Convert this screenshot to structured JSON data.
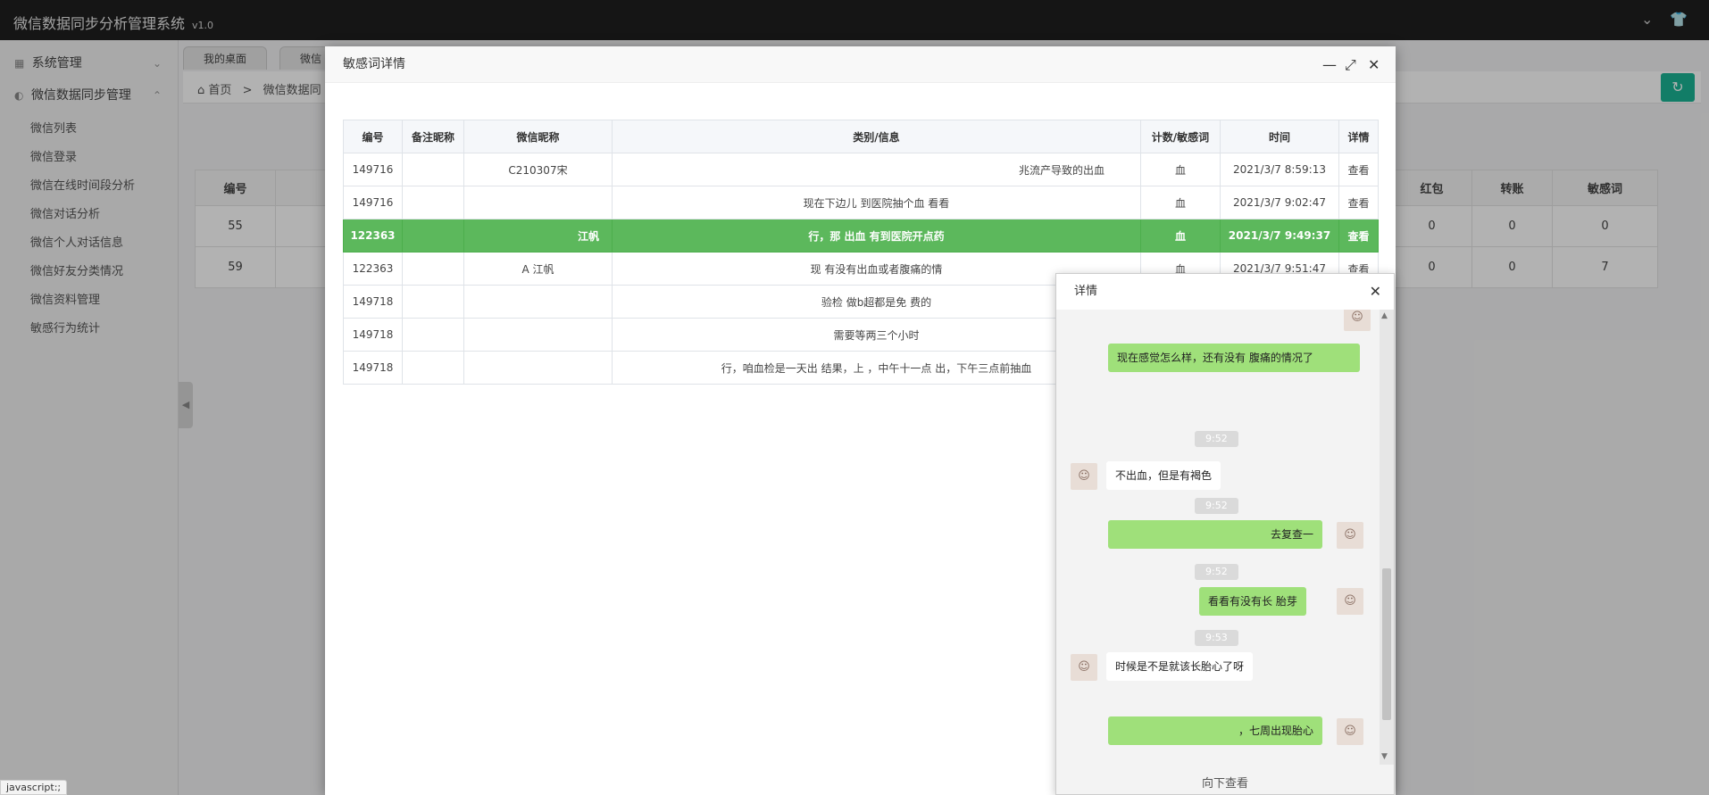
{
  "app": {
    "title": "微信数据同步分析管理系统",
    "version": "v1.0"
  },
  "sidebar": {
    "groups": [
      {
        "label": "系统管理"
      },
      {
        "label": "微信数据同步管理"
      }
    ],
    "items": [
      {
        "label": "微信列表"
      },
      {
        "label": "微信登录"
      },
      {
        "label": "微信在线时间段分析"
      },
      {
        "label": "微信对话分析"
      },
      {
        "label": "微信个人对话信息"
      },
      {
        "label": "微信好友分类情况"
      },
      {
        "label": "微信资料管理"
      },
      {
        "label": "敏感行为统计"
      }
    ]
  },
  "tabs": [
    {
      "label": "我的桌面"
    },
    {
      "label": "微信"
    }
  ],
  "breadcrumb": {
    "home": "首页",
    "separator": ">",
    "current": "微信数据同"
  },
  "background_table": {
    "headers": [
      "编号",
      "",
      "",
      "",
      "",
      "",
      "",
      "",
      "红包",
      "转账",
      "敏感词"
    ],
    "rows": [
      [
        "55",
        "",
        "",
        "",
        "",
        "",
        "",
        "",
        "0",
        "0",
        "0"
      ],
      [
        "59",
        "",
        "",
        "",
        "",
        "",
        "",
        "",
        "0",
        "0",
        "7"
      ]
    ]
  },
  "status_tip": "javascript:;",
  "modal": {
    "title": "敏感词详情",
    "columns": [
      "编号",
      "备注昵称",
      "微信昵称",
      "类别/信息",
      "计数/敏感词",
      "时间",
      "详情"
    ],
    "rows": [
      {
        "id": "149716",
        "remark": "",
        "nickname": "C210307宋",
        "info": "兆流产导致的出血",
        "word": "血",
        "time": "2021/3/7 8:59:13",
        "action": "查看",
        "selected": false
      },
      {
        "id": "149716",
        "remark": "",
        "nickname": "",
        "info": "现在下边儿                          到医院抽个血 看看",
        "word": "血",
        "time": "2021/3/7 9:02:47",
        "action": "查看",
        "selected": false
      },
      {
        "id": "122363",
        "remark": "",
        "nickname": "江帆",
        "info": "行，那         出血     有到医院开点药",
        "word": "血",
        "time": "2021/3/7 9:49:37",
        "action": "查看",
        "selected": true
      },
      {
        "id": "122363",
        "remark": "",
        "nickname": "A              江帆",
        "info": "现       有没有出血或者腹痛的情",
        "word": "血",
        "time": "2021/3/7 9:51:47",
        "action": "查看",
        "selected": false
      },
      {
        "id": "149718",
        "remark": "",
        "nickname": "",
        "info": "验检 做b超都是免 费的",
        "word": "",
        "time": "",
        "action": "",
        "selected": false
      },
      {
        "id": "149718",
        "remark": "",
        "nickname": "",
        "info": "需要等两三个小时",
        "word": "",
        "time": "",
        "action": "",
        "selected": false
      },
      {
        "id": "149718",
        "remark": "",
        "nickname": "",
        "info": "行，咱血检是一天出     结果，上           ，中午十一点     出，下午三点前抽血",
        "word": "",
        "time": "",
        "action": "",
        "selected": false
      }
    ]
  },
  "chat": {
    "title": "详情",
    "messages": [
      {
        "type": "bubble",
        "side": "me",
        "text": "现在感觉怎么样，还有没有     腹痛的情况了"
      },
      {
        "type": "time",
        "text": "9:52"
      },
      {
        "type": "bubble",
        "side": "other",
        "text": "不出血，但是有褐色"
      },
      {
        "type": "time",
        "text": "9:52"
      },
      {
        "type": "bubble",
        "side": "me",
        "text": "去复查一"
      },
      {
        "type": "time",
        "text": "9:52"
      },
      {
        "type": "bubble",
        "side": "me",
        "text": "看看有没有长     胎芽"
      },
      {
        "type": "time",
        "text": "9:53"
      },
      {
        "type": "bubble",
        "side": "other",
        "text": "时候是不是就该长胎心了呀"
      },
      {
        "type": "bubble",
        "side": "me",
        "text": "，七周出现胎心"
      }
    ],
    "footer": "向下查看"
  },
  "colors": {
    "accent": "#5cb85c",
    "topbar": "#1f1f1f",
    "refresh": "#1ab394",
    "chat_me": "#9fe07a"
  },
  "icons": [
    "home-icon",
    "chevron-down-icon",
    "shirt-icon",
    "refresh-icon",
    "minimize-icon",
    "maximize-icon",
    "close-icon"
  ]
}
